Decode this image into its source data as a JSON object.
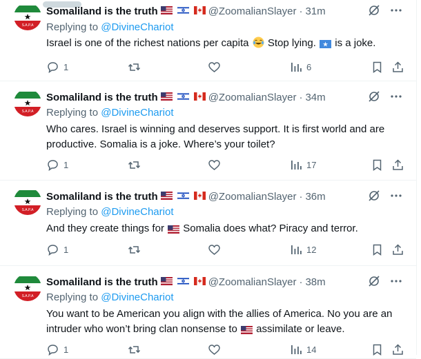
{
  "tweets": [
    {
      "display_name": "Somaliland is the truth",
      "flags": [
        "us-flag",
        "israel-flag",
        "canada-flag"
      ],
      "handle": "@ZoomalianSlayer",
      "separator": "·",
      "time": "31m",
      "replying_prefix": "Replying to",
      "replying_to": "@DivineChariot",
      "text_parts": [
        "Israel is one of the richest nations per capita ",
        " Stop lying. ",
        " is a joke."
      ],
      "emojis": [
        "joy-emoji",
        "somalia-flag"
      ],
      "replies": "1",
      "retweets": "",
      "likes": "",
      "views": "6"
    },
    {
      "display_name": "Somaliland is the truth",
      "flags": [
        "us-flag",
        "israel-flag",
        "canada-flag"
      ],
      "handle": "@ZoomalianSlayer",
      "separator": "·",
      "time": "34m",
      "replying_prefix": "Replying to",
      "replying_to": "@DivineChariot",
      "text": "Who cares. Israel is winning and deserves support. It is first world and are productive. Somalia is a joke. Where’s your toilet?",
      "replies": "1",
      "retweets": "",
      "likes": "",
      "views": "17"
    },
    {
      "display_name": "Somaliland is the truth",
      "flags": [
        "us-flag",
        "israel-flag",
        "canada-flag"
      ],
      "handle": "@ZoomalianSlayer",
      "separator": "·",
      "time": "36m",
      "replying_prefix": "Replying to",
      "replying_to": "@DivineChariot",
      "text_parts": [
        "And they create things for ",
        " Somalia does what? Piracy and terror."
      ],
      "emojis": [
        "us-flag"
      ],
      "replies": "1",
      "retweets": "",
      "likes": "",
      "views": "12"
    },
    {
      "display_name": "Somaliland is the truth",
      "flags": [
        "us-flag",
        "israel-flag",
        "canada-flag"
      ],
      "handle": "@ZoomalianSlayer",
      "separator": "·",
      "time": "38m",
      "replying_prefix": "Replying to",
      "replying_to": "@DivineChariot",
      "text_parts": [
        "You want to be American you align with the allies of America. No you are an intruder who won’t bring clan nonsense to ",
        " assimilate or leave."
      ],
      "emojis": [
        "us-flag"
      ],
      "replies": "1",
      "retweets": "",
      "likes": "",
      "views": "14"
    }
  ],
  "avatar_text": "S.A.P.A",
  "colors": {
    "link": "#1d9bf0",
    "secondary_text": "#536471",
    "primary_text": "#0f1419",
    "divider": "#eff3f4",
    "somaliland_green": "#1f8a3b",
    "somaliland_red": "#d21f26"
  }
}
